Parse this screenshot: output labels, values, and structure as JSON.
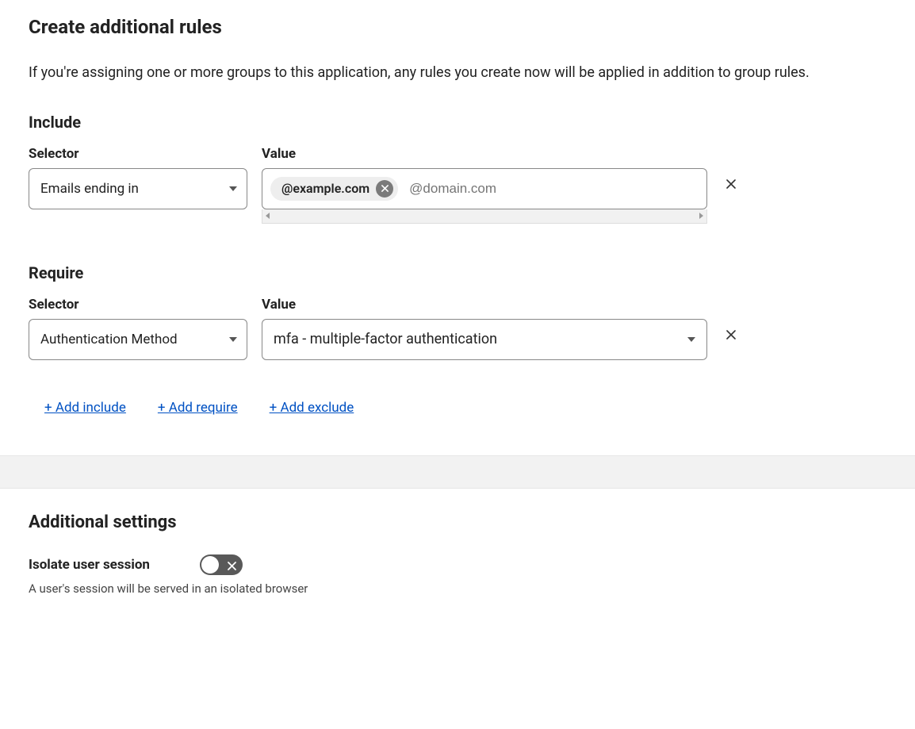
{
  "heading": "Create additional rules",
  "description": "If you're assigning one or more groups to this application, any rules you create now will be applied in addition to group rules.",
  "include": {
    "title": "Include",
    "selector_label": "Selector",
    "value_label": "Value",
    "selector_value": "Emails ending in",
    "chip_value": "@example.com",
    "placeholder": "@domain.com"
  },
  "require": {
    "title": "Require",
    "selector_label": "Selector",
    "value_label": "Value",
    "selector_value": "Authentication Method",
    "dropdown_value": "mfa - multiple-factor authentication"
  },
  "actions": {
    "add_include": "+ Add include",
    "add_require": "+ Add require",
    "add_exclude": "+ Add exclude"
  },
  "settings": {
    "heading": "Additional settings",
    "isolate_label": "Isolate user session",
    "isolate_desc": "A user's session will be served in an isolated browser",
    "isolate_enabled": false
  }
}
